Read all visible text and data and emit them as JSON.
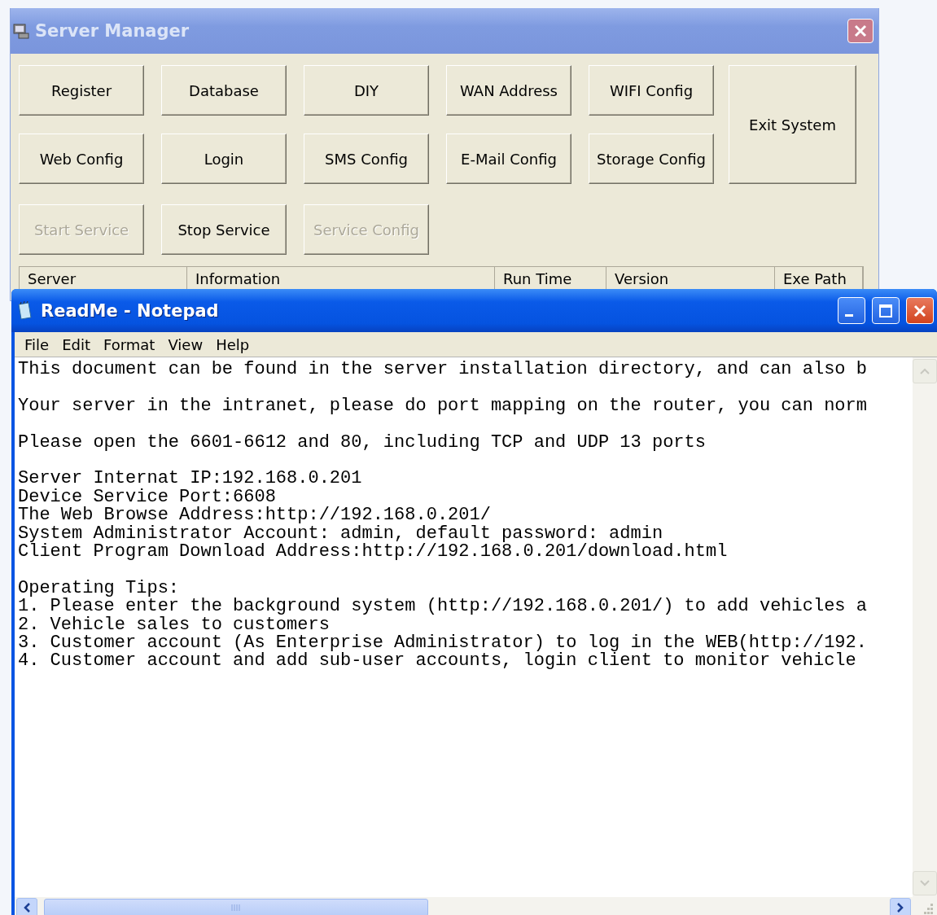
{
  "server_manager": {
    "title": "Server Manager",
    "buttons": [
      {
        "label": "Register",
        "disabled": false
      },
      {
        "label": "Database",
        "disabled": false
      },
      {
        "label": "DIY",
        "disabled": false
      },
      {
        "label": "WAN Address",
        "disabled": false
      },
      {
        "label": "WIFI Config",
        "disabled": false
      },
      {
        "label": "Web Config",
        "disabled": false
      },
      {
        "label": "Login",
        "disabled": false
      },
      {
        "label": "SMS Config",
        "disabled": false
      },
      {
        "label": "E-Mail Config",
        "disabled": false
      },
      {
        "label": "Storage Config",
        "disabled": false
      },
      {
        "label": "Start Service",
        "disabled": true
      },
      {
        "label": "Stop Service",
        "disabled": false
      },
      {
        "label": "Service Config",
        "disabled": true
      }
    ],
    "exit_button": "Exit System",
    "table": {
      "columns": [
        "Server",
        "Information",
        "Run Time",
        "Version",
        "Exe Path"
      ]
    }
  },
  "notepad": {
    "title": "ReadMe - Notepad",
    "menu": [
      "File",
      "Edit",
      "Format",
      "View",
      "Help"
    ],
    "paragraphs": [
      [
        "This document can be found in the server installation directory, and can also b"
      ],
      [
        "Your server in the intranet, please do port mapping on the router, you can norm"
      ],
      [
        "Please open the 6601-6612 and 80, including TCP and UDP 13 ports"
      ],
      [
        "Server Internat IP:192.168.0.201",
        "Device Service Port:6608",
        "The Web Browse Address:http://192.168.0.201/",
        "System Administrator Account: admin, default password: admin",
        "Client Program Download Address:http://192.168.0.201/download.html"
      ],
      [
        "Operating Tips:",
        "1. Please enter the background system (http://192.168.0.201/) to add vehicles a",
        "2. Vehicle sales to customers",
        "3. Customer account (As Enterprise Administrator) to log in the WEB(http://192.",
        "4. Customer account and add sub-user accounts, login client to monitor vehicle"
      ]
    ]
  }
}
